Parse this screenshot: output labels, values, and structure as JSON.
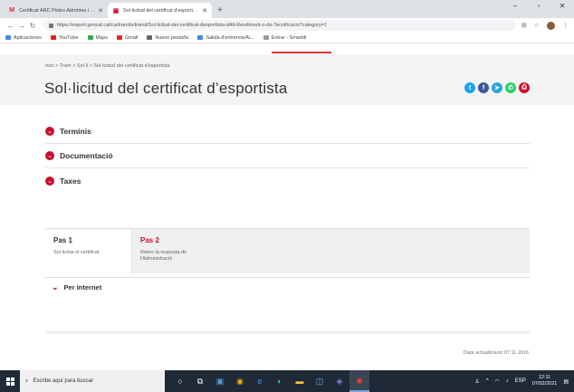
{
  "browser": {
    "tabs": [
      {
        "title": "Certificat ARC Pistes Atèrrides i F...",
        "icon": "gmail-icon",
        "active": false
      },
      {
        "title": "Sol·licitud del certificat d'esportis...",
        "icon": "gencat-icon",
        "active": true
      }
    ],
    "new_tab": "+",
    "url": "https://esport.gencat.cat/ca/tramits/tramit/Sol-licitud-del-certificat-desportista-dAlt-Rendiment-o-de-Tecnificacio?category=1",
    "bookmarks": [
      "Aplicaciones",
      "YouTube",
      "Maps",
      "Gmail",
      "Nuevo pestaña",
      "Salida d'entrenos/Ai...",
      "Entrar - Smartdi"
    ]
  },
  "page": {
    "breadcrumb": "Inici  >  Tràm  >  Sol·li  >  Sol·licitud del certificat d'esportista",
    "title": "Sol·licitud del certificat d’esportista",
    "share": [
      {
        "name": "twitter-icon",
        "glyph": "t",
        "color": "#1da1f2"
      },
      {
        "name": "facebook-icon",
        "glyph": "f",
        "color": "#3b5998"
      },
      {
        "name": "telegram-icon",
        "glyph": "➤",
        "color": "#2ca5e0"
      },
      {
        "name": "whatsapp-icon",
        "glyph": "w",
        "color": "#25d366"
      },
      {
        "name": "print-icon",
        "glyph": "⎙",
        "color": "#c8102e"
      }
    ],
    "sections": [
      "Terminis",
      "Documentació",
      "Taxes"
    ],
    "steps": [
      {
        "title": "Pas 1",
        "desc": "Sol·licitar el certificat"
      },
      {
        "title": "Pas 2",
        "desc": "Rebre la resposta de l'Administració"
      }
    ],
    "channel": "Per Internet",
    "updated": "Data actualització 07.11.2016"
  },
  "taskbar": {
    "search_placeholder": "Escribe aquí para buscar",
    "time": "12:11",
    "date": "07/02/2021",
    "lang": "ESP"
  }
}
